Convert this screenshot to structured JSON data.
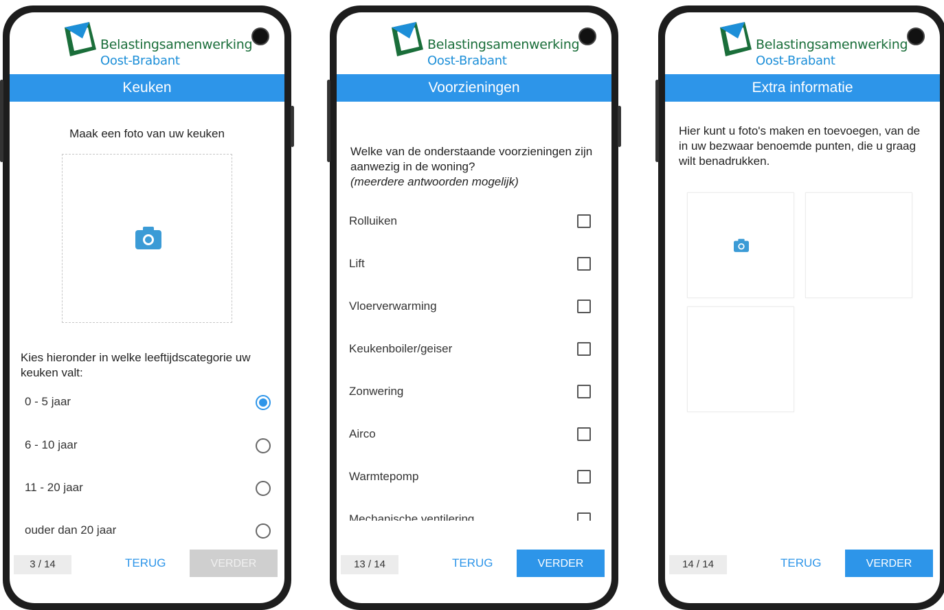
{
  "brand": {
    "name_line1": "Belastingsamenwerking",
    "name_line2": "Oost-Brabant",
    "color_primary": "#2d95e9",
    "color_green": "#1a6e3a"
  },
  "screens": [
    {
      "title": "Keuken",
      "photo_prompt": "Maak een foto van uw keuken",
      "category_prompt": "Kies hieronder in welke leeftijdscategorie uw keuken valt:",
      "options": [
        {
          "label": "0 - 5 jaar",
          "selected": true
        },
        {
          "label": "6 - 10 jaar",
          "selected": false
        },
        {
          "label": "11 - 20 jaar",
          "selected": false
        },
        {
          "label": "ouder dan 20 jaar",
          "selected": false
        }
      ],
      "footer": {
        "counter": "3 / 14",
        "back": "TERUG",
        "next": "VERDER",
        "next_enabled": false
      }
    },
    {
      "title": "Voorzieningen",
      "question": "Welke van de onderstaande voorzieningen zijn aanwezig in de woning?",
      "hint": "(meerdere antwoorden mogelijk)",
      "options": [
        {
          "label": "Rolluiken",
          "checked": false
        },
        {
          "label": "Lift",
          "checked": false
        },
        {
          "label": "Vloerverwarming",
          "checked": false
        },
        {
          "label": "Keukenboiler/geiser",
          "checked": false
        },
        {
          "label": "Zonwering",
          "checked": false
        },
        {
          "label": "Airco",
          "checked": false
        },
        {
          "label": "Warmtepomp",
          "checked": false
        },
        {
          "label": "Mechanische ventilering",
          "checked": false
        }
      ],
      "footer": {
        "counter": "13 / 14",
        "back": "TERUG",
        "next": "VERDER",
        "next_enabled": true
      }
    },
    {
      "title": "Extra informatie",
      "description": "Hier kunt u foto's maken en toevoegen, van de in uw bezwaar benoemde punten, die u graag wilt benadrukken.",
      "footer": {
        "counter": "14 / 14",
        "back": "TERUG",
        "next": "VERDER",
        "next_enabled": true
      }
    }
  ]
}
